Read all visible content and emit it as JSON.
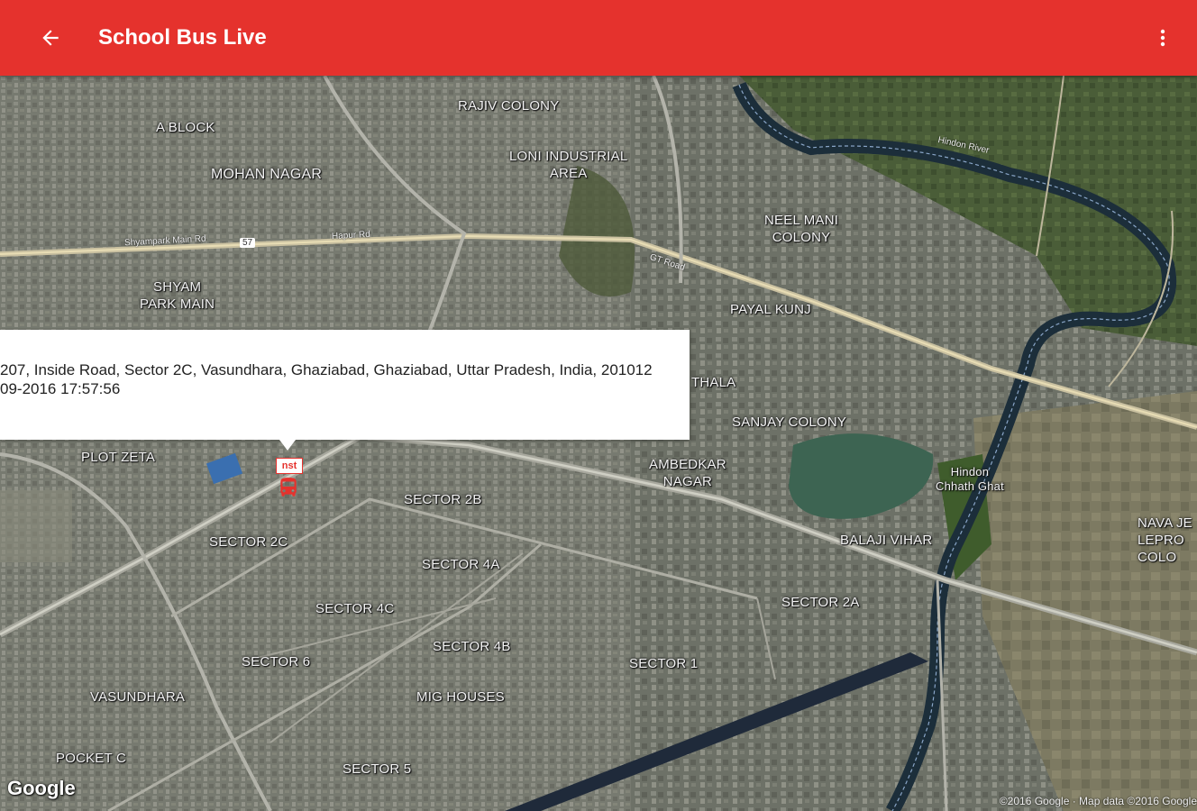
{
  "appbar": {
    "title": "School Bus Live",
    "back_icon": "arrow-back-icon",
    "menu_icon": "more-vert-icon",
    "color": "#e5322d"
  },
  "info_window": {
    "address": "207, Inside Road, Sector 2C, Vasundhara, Ghaziabad, Ghaziabad, Uttar Pradesh, India, 201012",
    "timestamp": "09-2016 17:57:56"
  },
  "marker": {
    "label": "nst",
    "icon": "bus-icon"
  },
  "map": {
    "type": "satellite",
    "labels": {
      "a_block": "A BLOCK",
      "rajiv_colony": "RAJIV COLONY",
      "mohan_nagar": "MOHAN NAGAR",
      "loni_industrial": "LONI INDUSTRIAL\nAREA",
      "neelmani_colony": "NEEL MANI\nCOLONY",
      "shyam_park": "SHYAM\nPARK MAIN",
      "payal_kunj": "PAYAL KUNJ",
      "thala": "THALA",
      "sanjay_colony": "SANJAY COLONY",
      "plot_zeta": "PLOT ZETA",
      "ambedkar_nagar": "AMBEDKAR\nNAGAR",
      "hindon_ghat": "Hindon\nChhath Ghat",
      "sector_2b": "SECTOR 2B",
      "sector_2c": "SECTOR 2C",
      "sector_4a": "SECTOR 4A",
      "balaji_vihar": "BALAJI VIHAR",
      "nava_jeevan": "NAVA JE\nLEPRO\nCOLO",
      "sector_2a": "SECTOR 2A",
      "sector_4c": "SECTOR 4C",
      "sector_4b": "SECTOR 4B",
      "sector_6": "SECTOR 6",
      "sector_1": "SECTOR 1",
      "vasundhara": "VASUNDHARA",
      "mig_houses": "MIG HOUSES",
      "pocket_c": "POCKET C",
      "sector_5": "SECTOR 5"
    },
    "road_labels": {
      "shyam_park_main": "Shyampark Main Rd",
      "shield": "57",
      "hapur_rd": "Hapur Rd",
      "gt_road": "GT Road",
      "hindon_river": "Hindon River"
    },
    "google_logo": "Google",
    "copyright": "©2016 Google · Map data ©2016 Google"
  }
}
